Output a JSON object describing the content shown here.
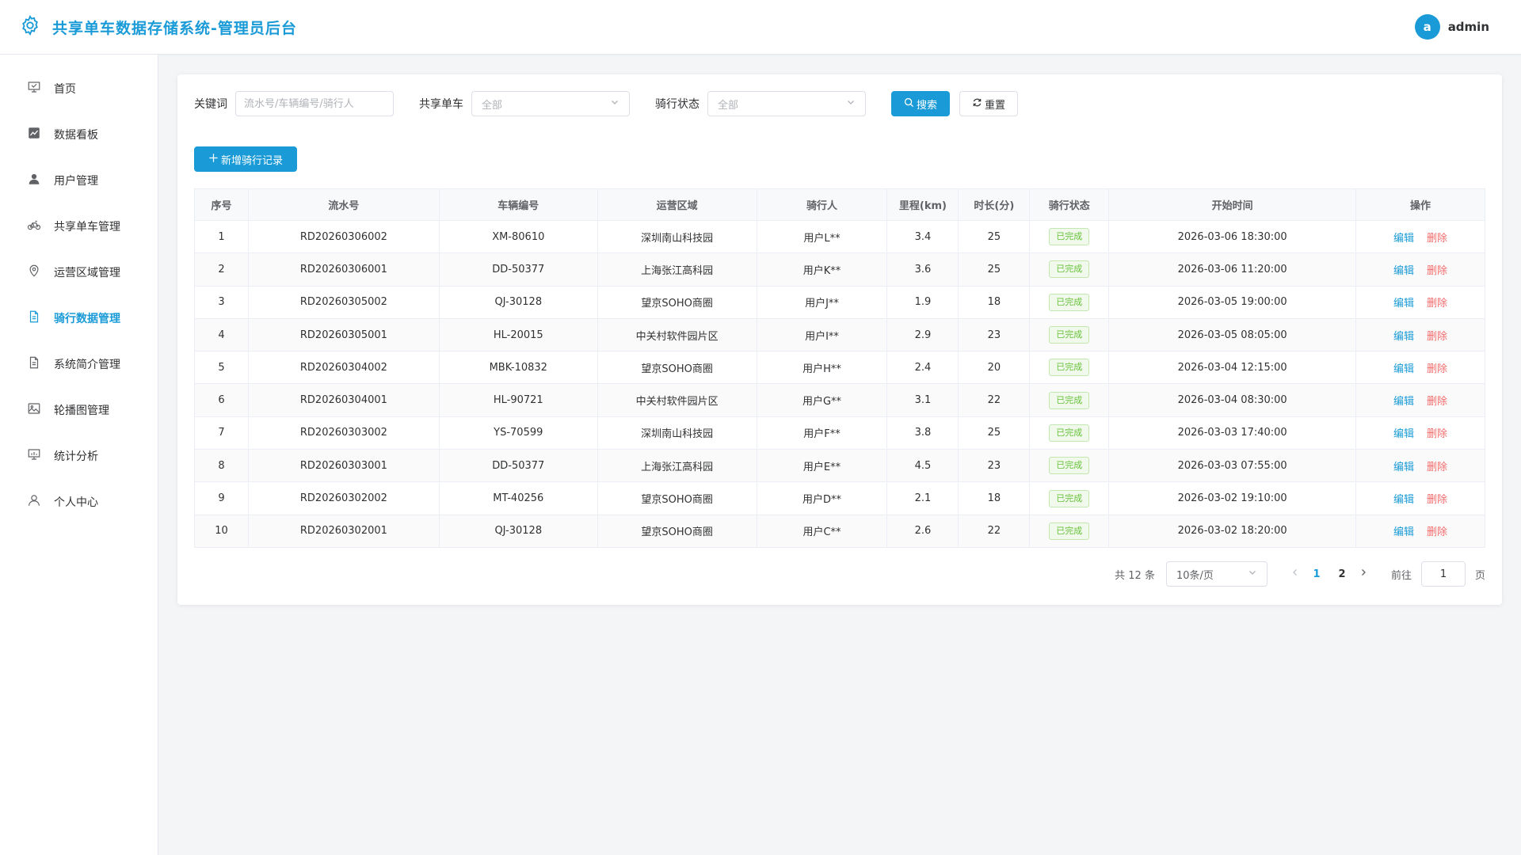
{
  "header": {
    "title": "共享单车数据存储系统-管理员后台",
    "avatar_letter": "a",
    "username": "admin",
    "accent": "#1a9bd7"
  },
  "sidebar": {
    "items": [
      {
        "label": "首页",
        "icon": "presentation-icon"
      },
      {
        "label": "数据看板",
        "icon": "chart-icon"
      },
      {
        "label": "用户管理",
        "icon": "user-icon"
      },
      {
        "label": "共享单车管理",
        "icon": "bicycle-icon"
      },
      {
        "label": "运营区域管理",
        "icon": "location-icon"
      },
      {
        "label": "骑行数据管理",
        "icon": "document-icon",
        "active": true
      },
      {
        "label": "系统简介管理",
        "icon": "document-icon"
      },
      {
        "label": "轮播图管理",
        "icon": "picture-icon"
      },
      {
        "label": "统计分析",
        "icon": "data-board-icon"
      },
      {
        "label": "个人中心",
        "icon": "user-outline-icon"
      }
    ]
  },
  "filters": {
    "keyword_label": "关键词",
    "keyword_placeholder": "流水号/车辆编号/骑行人",
    "bike_label": "共享单车",
    "bike_value": "全部",
    "status_label": "骑行状态",
    "status_value": "全部",
    "search_label": "搜索",
    "reset_label": "重置"
  },
  "toolbar": {
    "add_label": "新增骑行记录"
  },
  "table": {
    "columns": [
      "序号",
      "流水号",
      "车辆编号",
      "运营区域",
      "骑行人",
      "里程(km)",
      "时长(分)",
      "骑行状态",
      "开始时间",
      "操作"
    ],
    "rows": [
      {
        "no": "1",
        "serial": "RD20260306002",
        "bike": "XM-80610",
        "area": "深圳南山科技园",
        "rider": "用户L**",
        "km": "3.4",
        "min": "25",
        "status": "已完成",
        "start": "2026-03-06 18:30:00"
      },
      {
        "no": "2",
        "serial": "RD20260306001",
        "bike": "DD-50377",
        "area": "上海张江高科园",
        "rider": "用户K**",
        "km": "3.6",
        "min": "25",
        "status": "已完成",
        "start": "2026-03-06 11:20:00"
      },
      {
        "no": "3",
        "serial": "RD20260305002",
        "bike": "QJ-30128",
        "area": "望京SOHO商圈",
        "rider": "用户J**",
        "km": "1.9",
        "min": "18",
        "status": "已完成",
        "start": "2026-03-05 19:00:00"
      },
      {
        "no": "4",
        "serial": "RD20260305001",
        "bike": "HL-20015",
        "area": "中关村软件园片区",
        "rider": "用户I**",
        "km": "2.9",
        "min": "23",
        "status": "已完成",
        "start": "2026-03-05 08:05:00"
      },
      {
        "no": "5",
        "serial": "RD20260304002",
        "bike": "MBK-10832",
        "area": "望京SOHO商圈",
        "rider": "用户H**",
        "km": "2.4",
        "min": "20",
        "status": "已完成",
        "start": "2026-03-04 12:15:00"
      },
      {
        "no": "6",
        "serial": "RD20260304001",
        "bike": "HL-90721",
        "area": "中关村软件园片区",
        "rider": "用户G**",
        "km": "3.1",
        "min": "22",
        "status": "已完成",
        "start": "2026-03-04 08:30:00"
      },
      {
        "no": "7",
        "serial": "RD20260303002",
        "bike": "YS-70599",
        "area": "深圳南山科技园",
        "rider": "用户F**",
        "km": "3.8",
        "min": "25",
        "status": "已完成",
        "start": "2026-03-03 17:40:00"
      },
      {
        "no": "8",
        "serial": "RD20260303001",
        "bike": "DD-50377",
        "area": "上海张江高科园",
        "rider": "用户E**",
        "km": "4.5",
        "min": "23",
        "status": "已完成",
        "start": "2026-03-03 07:55:00"
      },
      {
        "no": "9",
        "serial": "RD20260302002",
        "bike": "MT-40256",
        "area": "望京SOHO商圈",
        "rider": "用户D**",
        "km": "2.1",
        "min": "18",
        "status": "已完成",
        "start": "2026-03-02 19:10:00"
      },
      {
        "no": "10",
        "serial": "RD20260302001",
        "bike": "QJ-30128",
        "area": "望京SOHO商圈",
        "rider": "用户C**",
        "km": "2.6",
        "min": "22",
        "status": "已完成",
        "start": "2026-03-02 18:20:00"
      }
    ],
    "edit_label": "编辑",
    "delete_label": "删除"
  },
  "pagination": {
    "total_text": "共 12 条",
    "page_size": "10条/页",
    "pages": [
      "1",
      "2"
    ],
    "current": "1",
    "goto_label": "前往",
    "goto_value": "1",
    "page_suffix": "页"
  }
}
